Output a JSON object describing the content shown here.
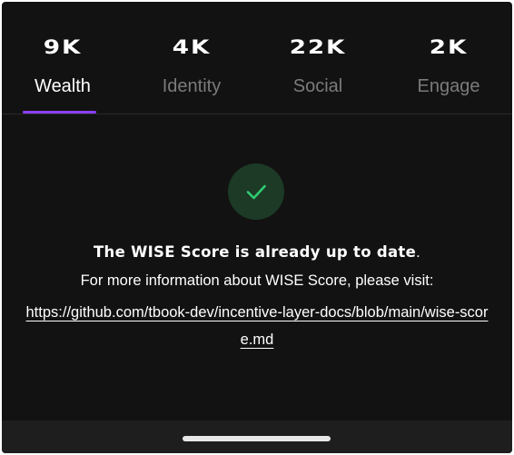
{
  "tabs": [
    {
      "value": "9K",
      "label": "Wealth",
      "active": true
    },
    {
      "value": "4K",
      "label": "Identity",
      "active": false
    },
    {
      "value": "22K",
      "label": "Social",
      "active": false
    },
    {
      "value": "2K",
      "label": "Engage",
      "active": false
    }
  ],
  "status": {
    "icon": "checkmark-icon",
    "title": "The WISE Score is already up to date",
    "title_punctuation": ".",
    "info": "For more information about WISE Score, please visit:",
    "link": "https://github.com/tbook-dev/incentive-layer-docs/blob/main/wise-score.md"
  },
  "colors": {
    "background": "#121212",
    "accent": "#8a3ffc",
    "success": "#2ecc71"
  }
}
